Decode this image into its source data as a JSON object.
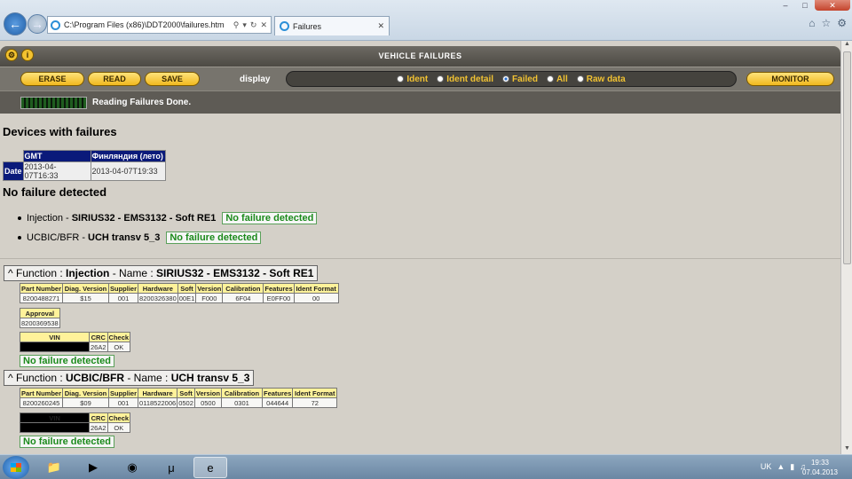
{
  "browser": {
    "address": "C:\\Program Files (x86)\\DDT2000\\failures.htm",
    "tab_label": "Failures",
    "window_buttons": [
      "–",
      "□",
      "✕"
    ]
  },
  "app": {
    "title": "VEHICLE FAILURES",
    "buttons": {
      "erase": "ERASE",
      "read": "READ",
      "save": "SAVE",
      "monitor": "MONITOR"
    },
    "display_label": "display",
    "display_options": [
      {
        "label": "Ident",
        "selected": false
      },
      {
        "label": "Ident detail",
        "selected": false
      },
      {
        "label": "Failed",
        "selected": true
      },
      {
        "label": "All",
        "selected": false
      },
      {
        "label": "Raw data",
        "selected": false
      }
    ],
    "status": "Reading Failures Done."
  },
  "devices": {
    "heading": "Devices with failures",
    "date_table": {
      "headers": [
        "GMT",
        "Финляндия (лето)"
      ],
      "row_label": "Date",
      "values": [
        "2013-04-07T16:33",
        "2013-04-07T19:33"
      ]
    }
  },
  "summary": {
    "heading": "No failure detected",
    "items": [
      {
        "prefix": "Injection - ",
        "name": "SIRIUS32 - EMS3132 - Soft RE1",
        "result": "No failure detected"
      },
      {
        "prefix": "UCBIC/BFR - ",
        "name": "UCH transv 5_3",
        "result": "No failure detected"
      }
    ]
  },
  "functions": [
    {
      "caret": "^",
      "label_function": "Function : ",
      "function": "Injection",
      "label_name": " - Name : ",
      "name": "SIRIUS32 - EMS3132 - Soft RE1",
      "ident_headers": [
        "Part Number",
        "Diag. Version",
        "Supplier",
        "Hardware",
        "Soft",
        "Version",
        "Calibration",
        "Features",
        "Ident Format"
      ],
      "ident_values": [
        "8200488271",
        "$15",
        "001",
        "8200326380",
        "00E1",
        "F000",
        "6F04",
        "E0FF00",
        "00"
      ],
      "approval_header": "Approval",
      "approval_value": "8200369538",
      "vin_headers": [
        "VIN",
        "CRC",
        "Check"
      ],
      "vin_values": [
        "",
        "26A2",
        "OK"
      ],
      "result": "No failure detected"
    },
    {
      "caret": "^",
      "label_function": "Function : ",
      "function": "UCBIC/BFR",
      "label_name": " - Name : ",
      "name": "UCH transv 5_3",
      "ident_headers": [
        "Part Number",
        "Diag. Version",
        "Supplier",
        "Hardware",
        "Soft",
        "Version",
        "Calibration",
        "Features",
        "Ident Format"
      ],
      "ident_values": [
        "8200260245",
        "$09",
        "001",
        "0118522006",
        "0502",
        "0500",
        "0301",
        "044644",
        "72"
      ],
      "vin_headers": [
        "VIN",
        "CRC",
        "Check"
      ],
      "vin_values": [
        "",
        "26A2",
        "OK"
      ],
      "result": "No failure detected"
    }
  ],
  "taskbar": {
    "lang": "UK",
    "time": "19:33",
    "date": "07.04.2013"
  }
}
